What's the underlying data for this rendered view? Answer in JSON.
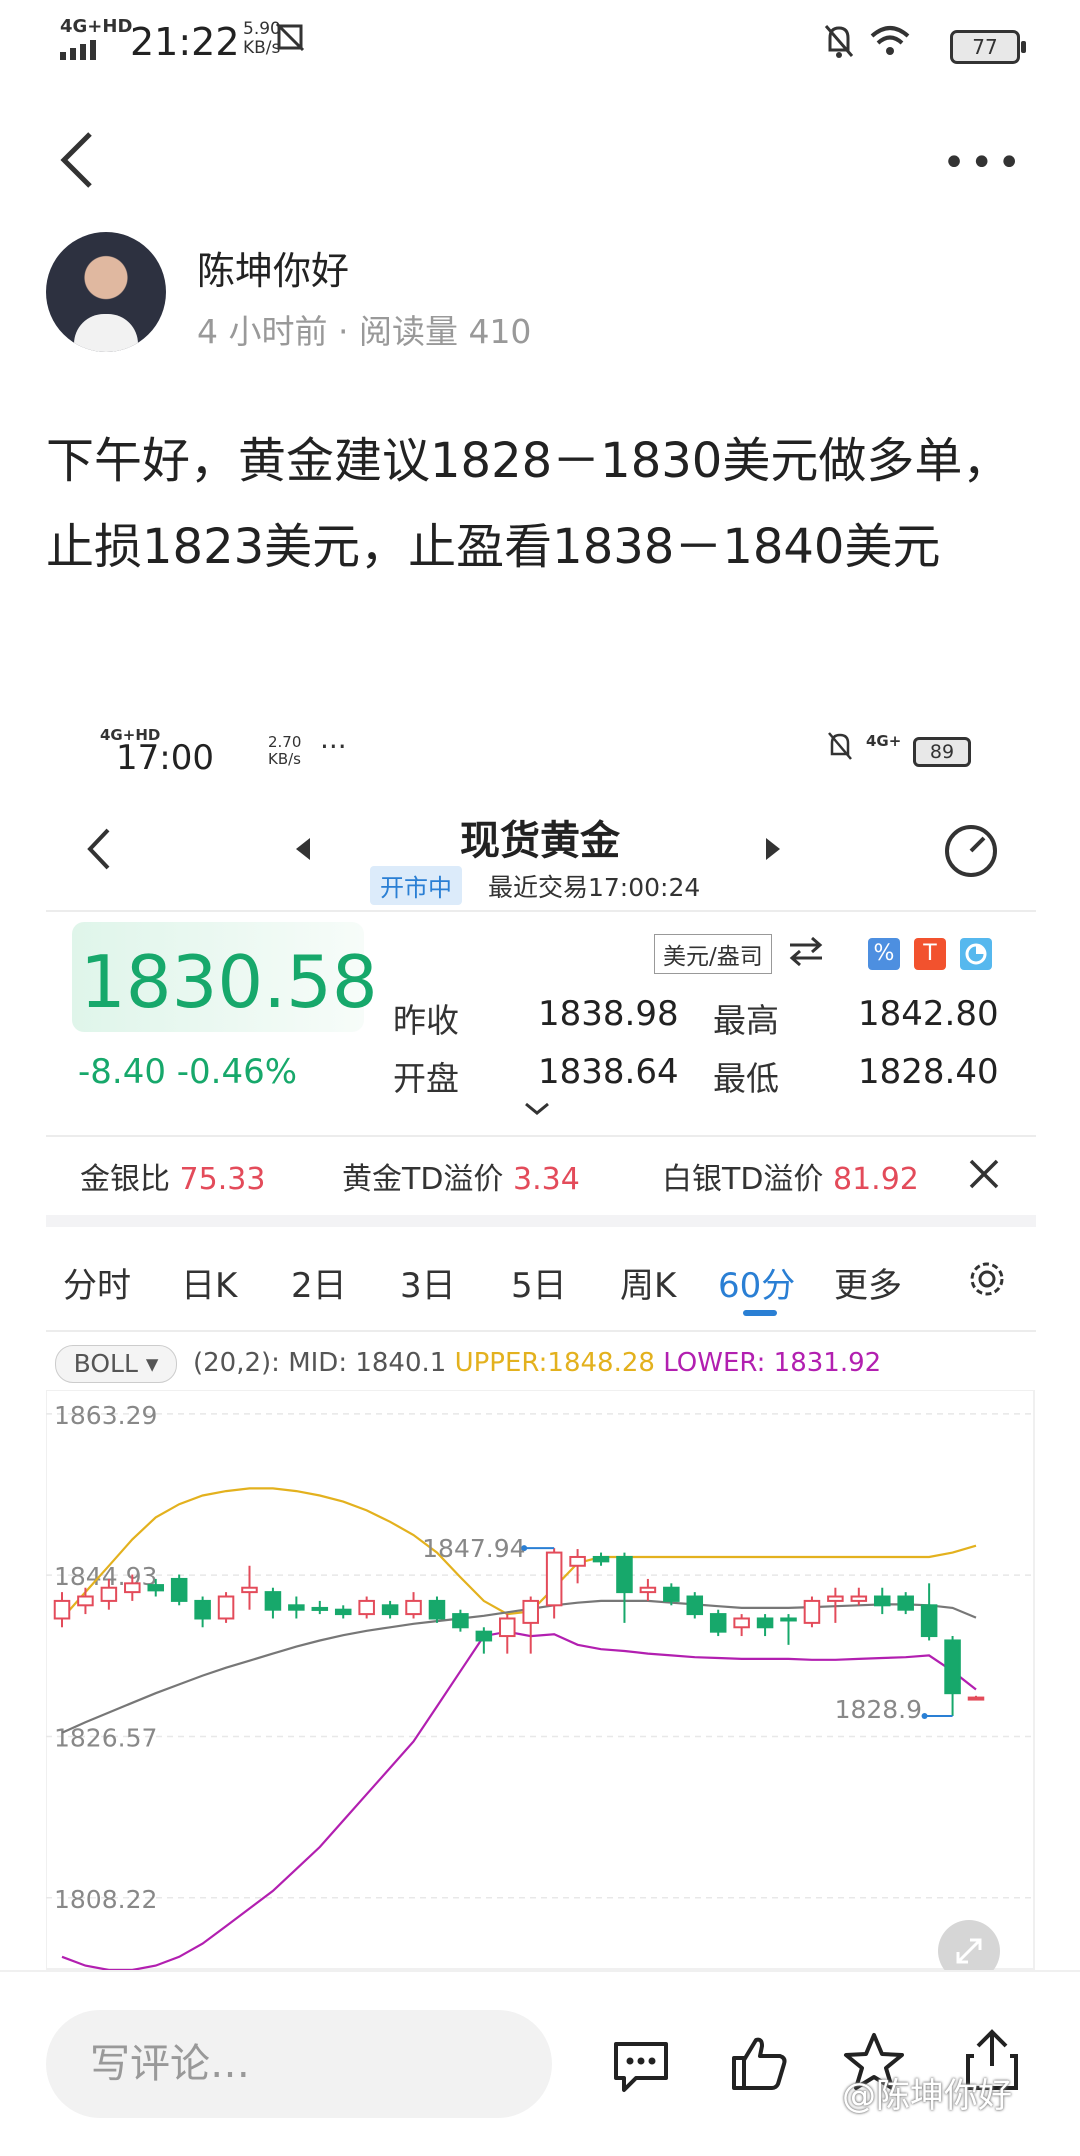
{
  "status_bar": {
    "network": "4G+HD",
    "time": "21:22",
    "speed_value": "5.90",
    "speed_unit": "KB/s",
    "battery": "77"
  },
  "header": {
    "back_icon": "chevron-left-icon",
    "more_icon": "more-dots-icon"
  },
  "author": {
    "name": "陈坤你好",
    "meta": "4 小时前 · 阅读量 410"
  },
  "post": {
    "text": "下午好，黄金建议1828－1830美元做多单，止损1823美元，止盈看1838－1840美元"
  },
  "embedded": {
    "status_bar": {
      "network": "4G+HD",
      "time": "17:00",
      "speed_value": "2.70",
      "speed_unit": "KB/s",
      "dots": "···",
      "network2": "4G+",
      "battery": "89"
    },
    "title": "现货黄金",
    "market_status": "开市中",
    "last_trade": "最近交易17:00:24",
    "price": "1830.58",
    "change": "-8.40  -0.46%",
    "unit": "美元/盎司",
    "stats": [
      {
        "label": "昨收",
        "value": "1838.98"
      },
      {
        "label": "最高",
        "value": "1842.80"
      },
      {
        "label": "开盘",
        "value": "1838.64"
      },
      {
        "label": "最低",
        "value": "1828.40"
      }
    ],
    "ratios": [
      {
        "label": "金银比",
        "value": "75.33"
      },
      {
        "label": "黄金TD溢价",
        "value": "3.34"
      },
      {
        "label": "白银TD溢价",
        "value": "81.92"
      }
    ],
    "tabs": [
      "分时",
      "日K",
      "2日",
      "3日",
      "5日",
      "周K",
      "60分",
      "更多"
    ],
    "active_tab": "60分",
    "indicator": "BOLL",
    "boll_params": "(20,2): MID: 1840.1",
    "boll_upper": "UPPER:1848.28",
    "boll_lower": "LOWER: 1831.92",
    "colors": {
      "up": "#e34b5a",
      "down": "#17a86b",
      "upper": "#e3b11e",
      "lower": "#b21fb0",
      "mid": "#777777",
      "accent": "#2a7fd4"
    }
  },
  "chart_data": {
    "type": "candlestick",
    "title": "",
    "y_ticks": [
      "1863.29",
      "1844.93",
      "1826.57",
      "1808.22"
    ],
    "ylim": [
      1800,
      1866
    ],
    "high_label": "1847.94",
    "low_label": "1828.9",
    "candles": [
      {
        "o": 1840.0,
        "c": 1842.0,
        "h": 1843.0,
        "l": 1839.0
      },
      {
        "o": 1841.5,
        "c": 1842.5,
        "h": 1843.5,
        "l": 1840.5
      },
      {
        "o": 1842.0,
        "c": 1843.5,
        "h": 1844.5,
        "l": 1841.0
      },
      {
        "o": 1843.0,
        "c": 1844.0,
        "h": 1845.0,
        "l": 1842.0
      },
      {
        "o": 1843.8,
        "c": 1843.2,
        "h": 1844.5,
        "l": 1842.5
      },
      {
        "o": 1844.5,
        "c": 1842.0,
        "h": 1845.0,
        "l": 1841.5
      },
      {
        "o": 1842.0,
        "c": 1840.0,
        "h": 1842.5,
        "l": 1839.0
      },
      {
        "o": 1840.0,
        "c": 1842.5,
        "h": 1843.0,
        "l": 1839.5
      },
      {
        "o": 1843.0,
        "c": 1843.5,
        "h": 1846.0,
        "l": 1841.0
      },
      {
        "o": 1843.0,
        "c": 1841.0,
        "h": 1843.5,
        "l": 1840.0
      },
      {
        "o": 1841.5,
        "c": 1841.0,
        "h": 1842.5,
        "l": 1840.0
      },
      {
        "o": 1841.2,
        "c": 1841.0,
        "h": 1842.0,
        "l": 1840.5
      },
      {
        "o": 1841.0,
        "c": 1840.5,
        "h": 1841.5,
        "l": 1840.0
      },
      {
        "o": 1840.5,
        "c": 1842.0,
        "h": 1842.5,
        "l": 1840.0
      },
      {
        "o": 1841.5,
        "c": 1840.5,
        "h": 1842.0,
        "l": 1840.0
      },
      {
        "o": 1840.5,
        "c": 1842.0,
        "h": 1843.0,
        "l": 1840.0
      },
      {
        "o": 1842.0,
        "c": 1840.0,
        "h": 1842.5,
        "l": 1839.5
      },
      {
        "o": 1840.5,
        "c": 1839.0,
        "h": 1841.0,
        "l": 1838.5
      },
      {
        "o": 1838.5,
        "c": 1837.5,
        "h": 1839.0,
        "l": 1836.0
      },
      {
        "o": 1838.0,
        "c": 1840.0,
        "h": 1840.5,
        "l": 1836.0
      },
      {
        "o": 1839.5,
        "c": 1842.0,
        "h": 1842.5,
        "l": 1836.0
      },
      {
        "o": 1841.5,
        "c": 1847.5,
        "h": 1848.0,
        "l": 1840.0
      },
      {
        "o": 1846.0,
        "c": 1847.0,
        "h": 1847.9,
        "l": 1844.0
      },
      {
        "o": 1847.0,
        "c": 1846.5,
        "h": 1847.5,
        "l": 1846.0
      },
      {
        "o": 1847.0,
        "c": 1843.0,
        "h": 1847.5,
        "l": 1839.5
      },
      {
        "o": 1843.0,
        "c": 1843.5,
        "h": 1844.5,
        "l": 1842.0
      },
      {
        "o": 1843.5,
        "c": 1842.0,
        "h": 1844.0,
        "l": 1841.5
      },
      {
        "o": 1842.5,
        "c": 1840.5,
        "h": 1843.0,
        "l": 1840.0
      },
      {
        "o": 1840.5,
        "c": 1838.5,
        "h": 1841.0,
        "l": 1838.0
      },
      {
        "o": 1839.0,
        "c": 1840.0,
        "h": 1840.5,
        "l": 1838.0
      },
      {
        "o": 1840.0,
        "c": 1839.0,
        "h": 1840.5,
        "l": 1838.0
      },
      {
        "o": 1840.0,
        "c": 1839.8,
        "h": 1840.5,
        "l": 1837.0
      },
      {
        "o": 1839.5,
        "c": 1842.0,
        "h": 1842.5,
        "l": 1839.0
      },
      {
        "o": 1842.0,
        "c": 1842.5,
        "h": 1843.5,
        "l": 1839.5
      },
      {
        "o": 1842.0,
        "c": 1842.5,
        "h": 1843.5,
        "l": 1841.5
      },
      {
        "o": 1842.5,
        "c": 1841.5,
        "h": 1843.5,
        "l": 1840.5
      },
      {
        "o": 1842.5,
        "c": 1841.0,
        "h": 1843.0,
        "l": 1840.5
      },
      {
        "o": 1841.5,
        "c": 1838.0,
        "h": 1844.0,
        "l": 1837.5
      },
      {
        "o": 1837.5,
        "c": 1831.5,
        "h": 1838.0,
        "l": 1828.9
      },
      {
        "o": 1831.0,
        "c": 1831.0,
        "h": 1831.2,
        "l": 1830.8
      }
    ],
    "upper": [
      1840,
      1843,
      1846,
      1849,
      1851.5,
      1853,
      1854,
      1854.5,
      1854.8,
      1854.8,
      1854.5,
      1854,
      1853.3,
      1852.3,
      1851,
      1849.5,
      1847.5,
      1844.7,
      1842,
      1840.5,
      1840.8,
      1843.5,
      1846.3,
      1847,
      1847,
      1847,
      1847,
      1847,
      1847,
      1847,
      1847,
      1847,
      1847,
      1847,
      1847,
      1847,
      1847,
      1847,
      1847.5,
      1848.28
    ],
    "mid": [
      1827,
      1828.2,
      1829.3,
      1830.4,
      1831.5,
      1832.5,
      1833.5,
      1834.4,
      1835.2,
      1836,
      1836.8,
      1837.5,
      1838.1,
      1838.6,
      1839,
      1839.4,
      1839.7,
      1840,
      1840.3,
      1840.7,
      1841.1,
      1841.5,
      1841.8,
      1842.0,
      1842.0,
      1842.0,
      1841.8,
      1841.6,
      1841.4,
      1841.2,
      1841.2,
      1841.2,
      1841.3,
      1841.4,
      1841.5,
      1841.6,
      1841.6,
      1841.5,
      1841.2,
      1840.1
    ],
    "lower": [
      1801.5,
      1800.5,
      1800,
      1800,
      1800.5,
      1801.5,
      1803,
      1805,
      1807,
      1809,
      1811.5,
      1814,
      1817,
      1820,
      1823,
      1826,
      1830,
      1834,
      1838,
      1838.5,
      1838,
      1838.2,
      1837,
      1836.5,
      1836.3,
      1836,
      1835.8,
      1835.6,
      1835.5,
      1835.4,
      1835.4,
      1835.4,
      1835.3,
      1835.3,
      1835.4,
      1835.5,
      1835.6,
      1835.8,
      1834,
      1831.92
    ]
  },
  "bottom_bar": {
    "comment_placeholder": "写评论…",
    "icons": [
      "comment-icon",
      "like-icon",
      "star-icon",
      "share-icon"
    ],
    "watermark": "@陈坤你好"
  }
}
